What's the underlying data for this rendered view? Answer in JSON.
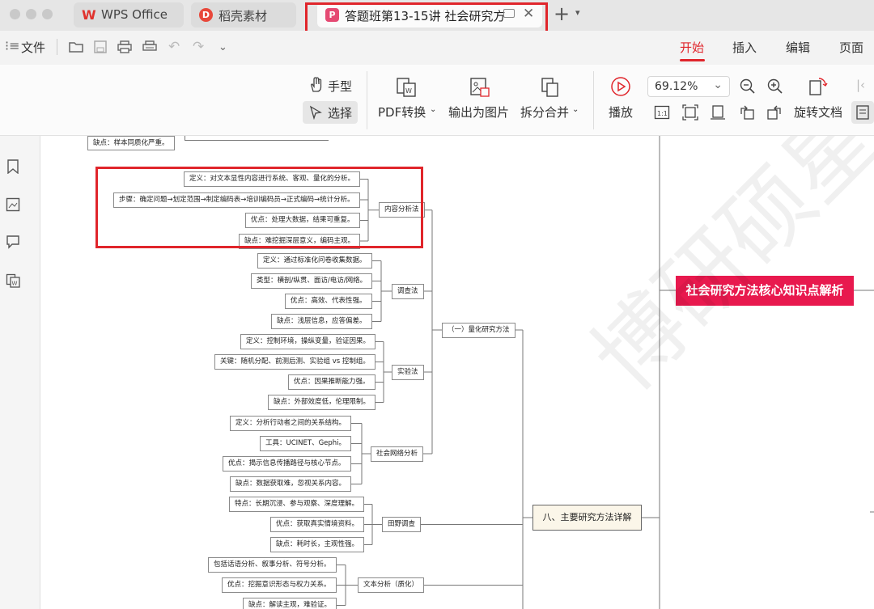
{
  "tabs": [
    {
      "label": "WPS Office",
      "logo": "W"
    },
    {
      "label": "稻壳素材",
      "logo": "D"
    },
    {
      "label": "答题班第13-15讲 社会研究方",
      "logo": "P",
      "active": true
    }
  ],
  "menu": {
    "file": "文件",
    "tabs": [
      "开始",
      "插入",
      "编辑",
      "页面"
    ],
    "active_tab_color": "#e0252b"
  },
  "ribbon": {
    "hand": "手型",
    "select": "选择",
    "pdf_convert": "PDF转换",
    "export_image": "输出为图片",
    "split_merge": "拆分合并",
    "play": "播放",
    "zoom": "69.12%",
    "rotate": "旋转文档"
  },
  "mindmap": {
    "root": "社会研究方法核心知识点解析",
    "section": "八、主要研究方法详解",
    "quant": "（一）量化研究方法",
    "top_item": "缺点：样本同质化严重。",
    "groups": [
      {
        "name": "内容分析法",
        "items": [
          "定义：对文本显性内容进行系统、客观、量化的分析。",
          "步骤：确定问题→划定范围→制定编码表→培训编码员→正式编码→统计分析。",
          "优点：处理大数据，结果可重复。",
          "缺点：难挖掘深层意义，编码主观。"
        ]
      },
      {
        "name": "调查法",
        "items": [
          "定义：通过标准化问卷收集数据。",
          "类型：横剖/纵贯、面访/电访/网络。",
          "优点：高效、代表性强。",
          "缺点：浅层信息，应答偏差。"
        ]
      },
      {
        "name": "实验法",
        "items": [
          "定义：控制环境，操纵变量，验证因果。",
          "关键：随机分配、前测后测、实验组 vs 控制组。",
          "优点：因果推断能力强。",
          "缺点：外部效度低，伦理限制。"
        ]
      },
      {
        "name": "社会网络分析",
        "items": [
          "定义：分析行动者之间的关系结构。",
          "工具：UCINET、Gephi。",
          "优点：揭示信息传播路径与核心节点。",
          "缺点：数据获取难，忽视关系内容。"
        ]
      },
      {
        "name": "田野调查",
        "items": [
          "特点：长期沉浸、参与观察、深度理解。",
          "优点：获取真实情境资料。",
          "缺点：耗时长，主观性强。"
        ]
      },
      {
        "name": "文本分析（质化）",
        "items": [
          "包括话语分析、叙事分析、符号分析。",
          "优点：挖掘意识形态与权力关系。",
          "缺点：解读主观，难验证。"
        ]
      }
    ]
  },
  "watermark": "博研硕星"
}
